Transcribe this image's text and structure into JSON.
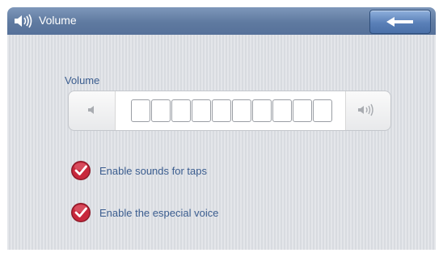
{
  "header": {
    "title": "Volume",
    "icon": "speaker-icon"
  },
  "back_button": {
    "icon": "arrow-left-icon"
  },
  "volume": {
    "label": "Volume",
    "level": 0,
    "segments_total": 10,
    "decrease_icon": "speaker-low-icon",
    "increase_icon": "speaker-high-icon"
  },
  "options": [
    {
      "label": "Enable sounds for taps",
      "checked": true
    },
    {
      "label": "Enable the especial voice",
      "checked": true
    }
  ],
  "colors": {
    "accent": "#5f7aa0",
    "label_text": "#3b5d8f",
    "check_red": "#c8283c"
  }
}
